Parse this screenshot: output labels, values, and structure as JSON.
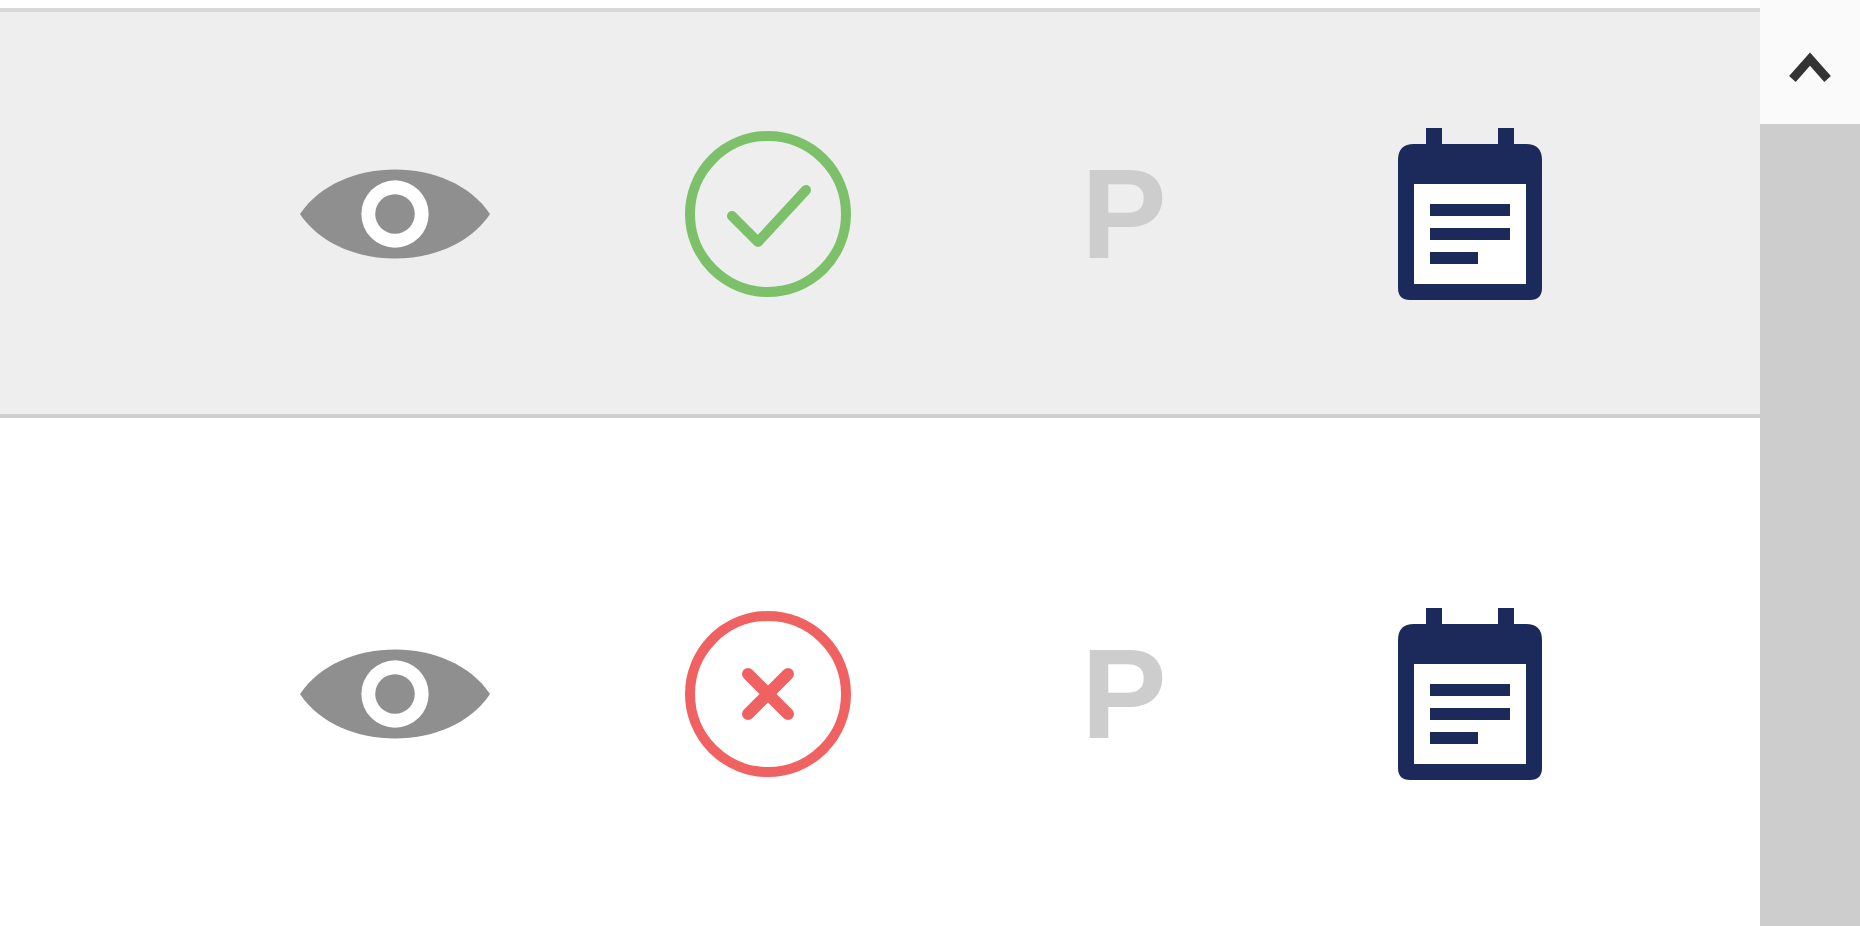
{
  "rows": [
    {
      "selected": true,
      "kind": "approved",
      "letter": "P"
    },
    {
      "selected": false,
      "kind": "rejected",
      "letter": "P"
    }
  ]
}
